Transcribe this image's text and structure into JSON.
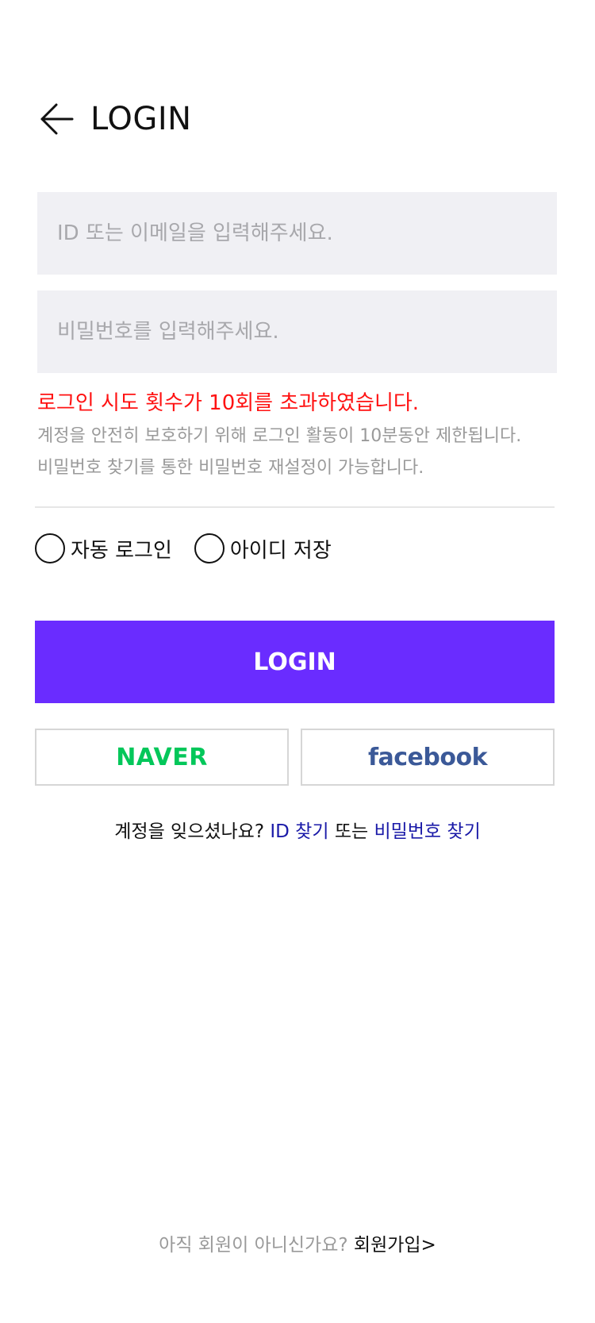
{
  "header": {
    "title": "LOGIN",
    "back_icon": "arrow-left-icon"
  },
  "form": {
    "id_placeholder": "ID 또는 이메일을 입력해주세요.",
    "id_value": "",
    "password_placeholder": "비밀번호를 입력해주세요.",
    "password_value": ""
  },
  "error": {
    "title": "로그인 시도 횟수가 10회를 초과하였습니다.",
    "line1": "계정을 안전히 보호하기 위해 로그인 활동이 10분동안 제한됩니다.",
    "line2": "비밀번호 찾기를 통한 비밀번호 재설정이 가능합니다.",
    "color": "#ff1212"
  },
  "options": {
    "auto_login": {
      "label": "자동 로그인",
      "checked": false
    },
    "save_id": {
      "label": "아이디 저장",
      "checked": false
    }
  },
  "login_button": {
    "label": "LOGIN",
    "color": "#6a2cff"
  },
  "social": {
    "naver_label": "NAVER",
    "naver_color": "#03c75a",
    "facebook_label": "facebook",
    "facebook_color": "#3b5998"
  },
  "forgot": {
    "prompt": "계정을 잊으셨나요?",
    "find_id": "ID 찾기",
    "or": "또는",
    "find_password": "비밀번호 찾기"
  },
  "signup": {
    "prompt": "아직 회원이 아니신가요?",
    "link": "회원가입>"
  }
}
